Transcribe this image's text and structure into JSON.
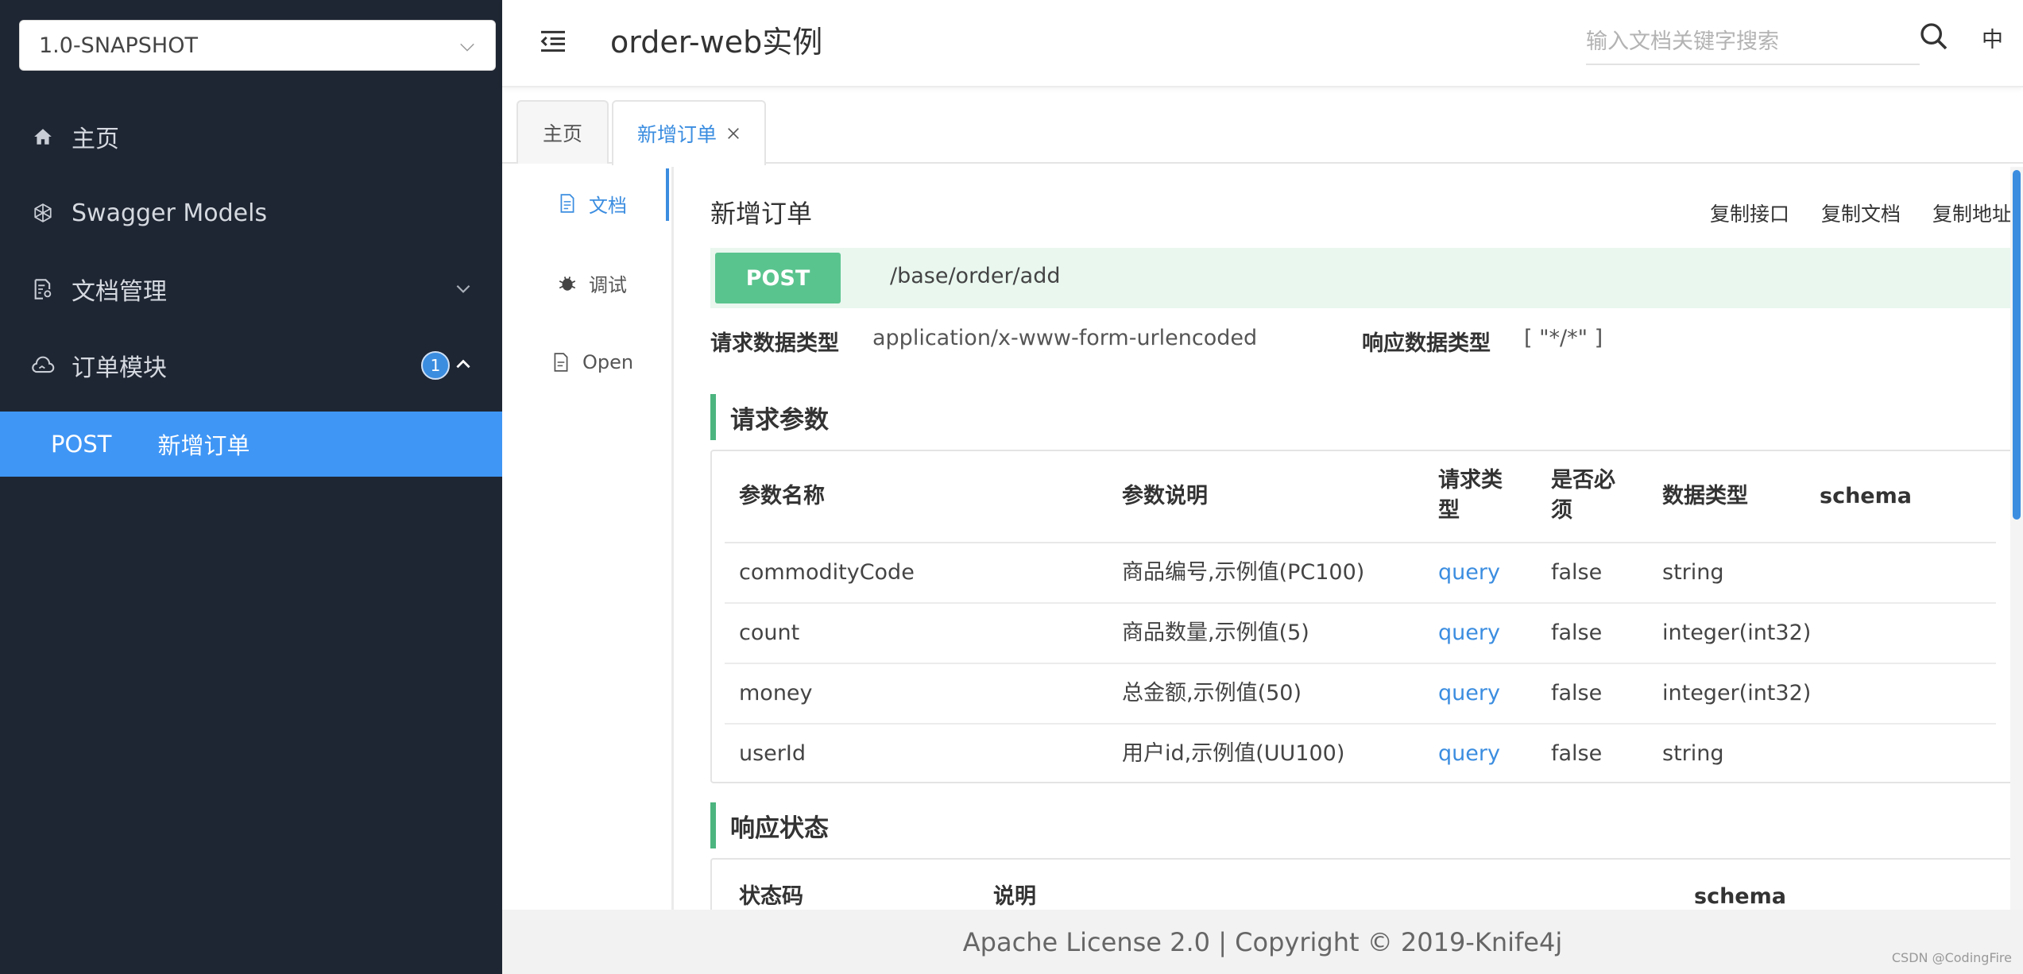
{
  "sidebar": {
    "version": "1.0-SNAPSHOT",
    "items": [
      {
        "label": "主页",
        "icon": "home-icon"
      },
      {
        "label": "Swagger Models",
        "icon": "models-icon"
      },
      {
        "label": "文档管理",
        "icon": "doc-manage-icon"
      },
      {
        "label": "订单模块",
        "icon": "cloud-icon",
        "badge": "1"
      }
    ],
    "active_sub": {
      "method": "POST",
      "label": "新增订单"
    }
  },
  "header": {
    "title": "order-web实例",
    "search_placeholder": "输入文档关键字搜索",
    "lang": "中"
  },
  "tabs": [
    {
      "label": "主页"
    },
    {
      "label": "新增订单",
      "active": true
    }
  ],
  "docmenu": [
    {
      "label": "文档",
      "icon": "document-icon",
      "active": true
    },
    {
      "label": "调试",
      "icon": "bug-icon"
    },
    {
      "label": "Open",
      "icon": "file-icon"
    }
  ],
  "api": {
    "title": "新增订单",
    "copy_links": [
      "复制接口",
      "复制文档",
      "复制地址"
    ],
    "method": "POST",
    "path": "/base/order/add",
    "req_type_label": "请求数据类型",
    "req_type": "application/x-www-form-urlencoded",
    "resp_type_label": "响应数据类型",
    "resp_type": "[ \"*/*\" ]"
  },
  "params": {
    "section_title": "请求参数",
    "headers": [
      "参数名称",
      "参数说明",
      "请求类型",
      "是否必须",
      "数据类型",
      "schema"
    ],
    "header_lines": {
      "req_type": [
        "请求类",
        "型"
      ],
      "required": [
        "是否必",
        "须"
      ]
    },
    "rows": [
      {
        "name": "commodityCode",
        "desc": "商品编号,示例值(PC100)",
        "in": "query",
        "required": "false",
        "type": "string",
        "schema": ""
      },
      {
        "name": "count",
        "desc": "商品数量,示例值(5)",
        "in": "query",
        "required": "false",
        "type": "integer(int32)",
        "schema": ""
      },
      {
        "name": "money",
        "desc": "总金额,示例值(50)",
        "in": "query",
        "required": "false",
        "type": "integer(int32)",
        "schema": ""
      },
      {
        "name": "userId",
        "desc": "用户id,示例值(UU100)",
        "in": "query",
        "required": "false",
        "type": "string",
        "schema": ""
      }
    ]
  },
  "responses": {
    "section_title": "响应状态",
    "headers": [
      "状态码",
      "说明",
      "schema"
    ]
  },
  "footer": "Apache License 2.0 | Copyright © 2019-Knife4j",
  "watermark": "CSDN @CodingFire",
  "colors": {
    "sidebar_bg": "#1f2633",
    "accent": "#3b8de0",
    "post": "#5ac48e",
    "section_bar": "#4cb57f"
  }
}
